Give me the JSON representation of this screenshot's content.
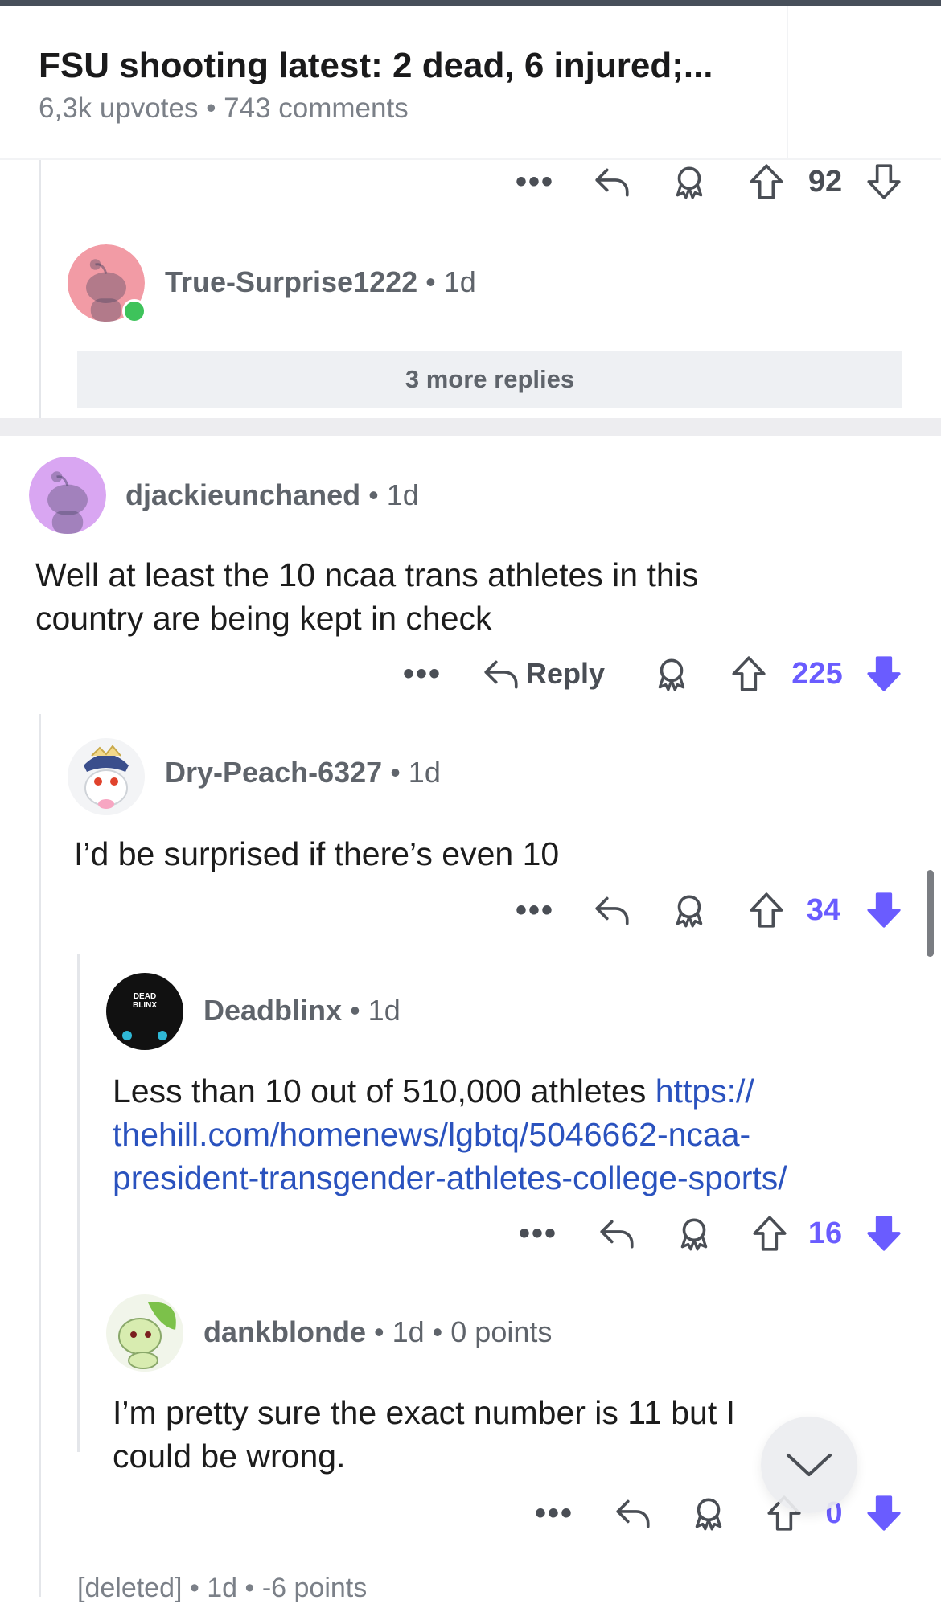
{
  "post": {
    "title": "FSU shooting latest: 2 dead, 6 injured;...",
    "meta": "6,3k upvotes • 743 comments"
  },
  "top_actions": {
    "dots": "•••",
    "votes": "92"
  },
  "more_replies": "3 more replies",
  "comments": [
    {
      "author": "True-Surprise1222",
      "time": "• 1d",
      "avatar_color": "#f29ba5",
      "online": true
    },
    {
      "author": "djackieunchaned",
      "time": "• 1d",
      "avatar_color": "#d9a6f2",
      "body": [
        "Well at least the 10 ncaa trans athletes in this",
        "country are being kept in check"
      ],
      "reply_label": "Reply",
      "votes": "225",
      "vote_state": "downvoted"
    },
    {
      "author": "Dry-Peach-6327",
      "time": "• 1d",
      "body": [
        "I’d be surprised if there’s even 10"
      ],
      "votes": "34",
      "vote_state": "downvoted"
    },
    {
      "author": "Deadblinx",
      "time": "• 1d",
      "avatar_text": [
        "DEAD",
        "BLINX"
      ],
      "body_prefix": "Less than 10 out of 510,000 athletes ",
      "link_lines": [
        "https://",
        "thehill.com/homenews/lgbtq/5046662-ncaa-",
        "president-transgender-athletes-college-sports/"
      ],
      "votes": "16",
      "vote_state": "downvoted"
    },
    {
      "author": "dankblonde",
      "time": "• 1d • 0 points",
      "body": [
        "I’m pretty sure the exact number is 11 but I",
        "could be wrong."
      ],
      "votes": "0",
      "vote_state": "downvoted"
    }
  ],
  "deleted_line": "[deleted] • 1d • -6 points",
  "colors": {
    "accent": "#6a5cff",
    "link": "#2a52be",
    "muted": "#5f646b",
    "online": "#3ec35b"
  },
  "icons": [
    "more-dots-icon",
    "reply-arrow-icon",
    "award-icon",
    "upvote-arrow-icon",
    "downvote-arrow-icon",
    "chevron-down-icon"
  ]
}
